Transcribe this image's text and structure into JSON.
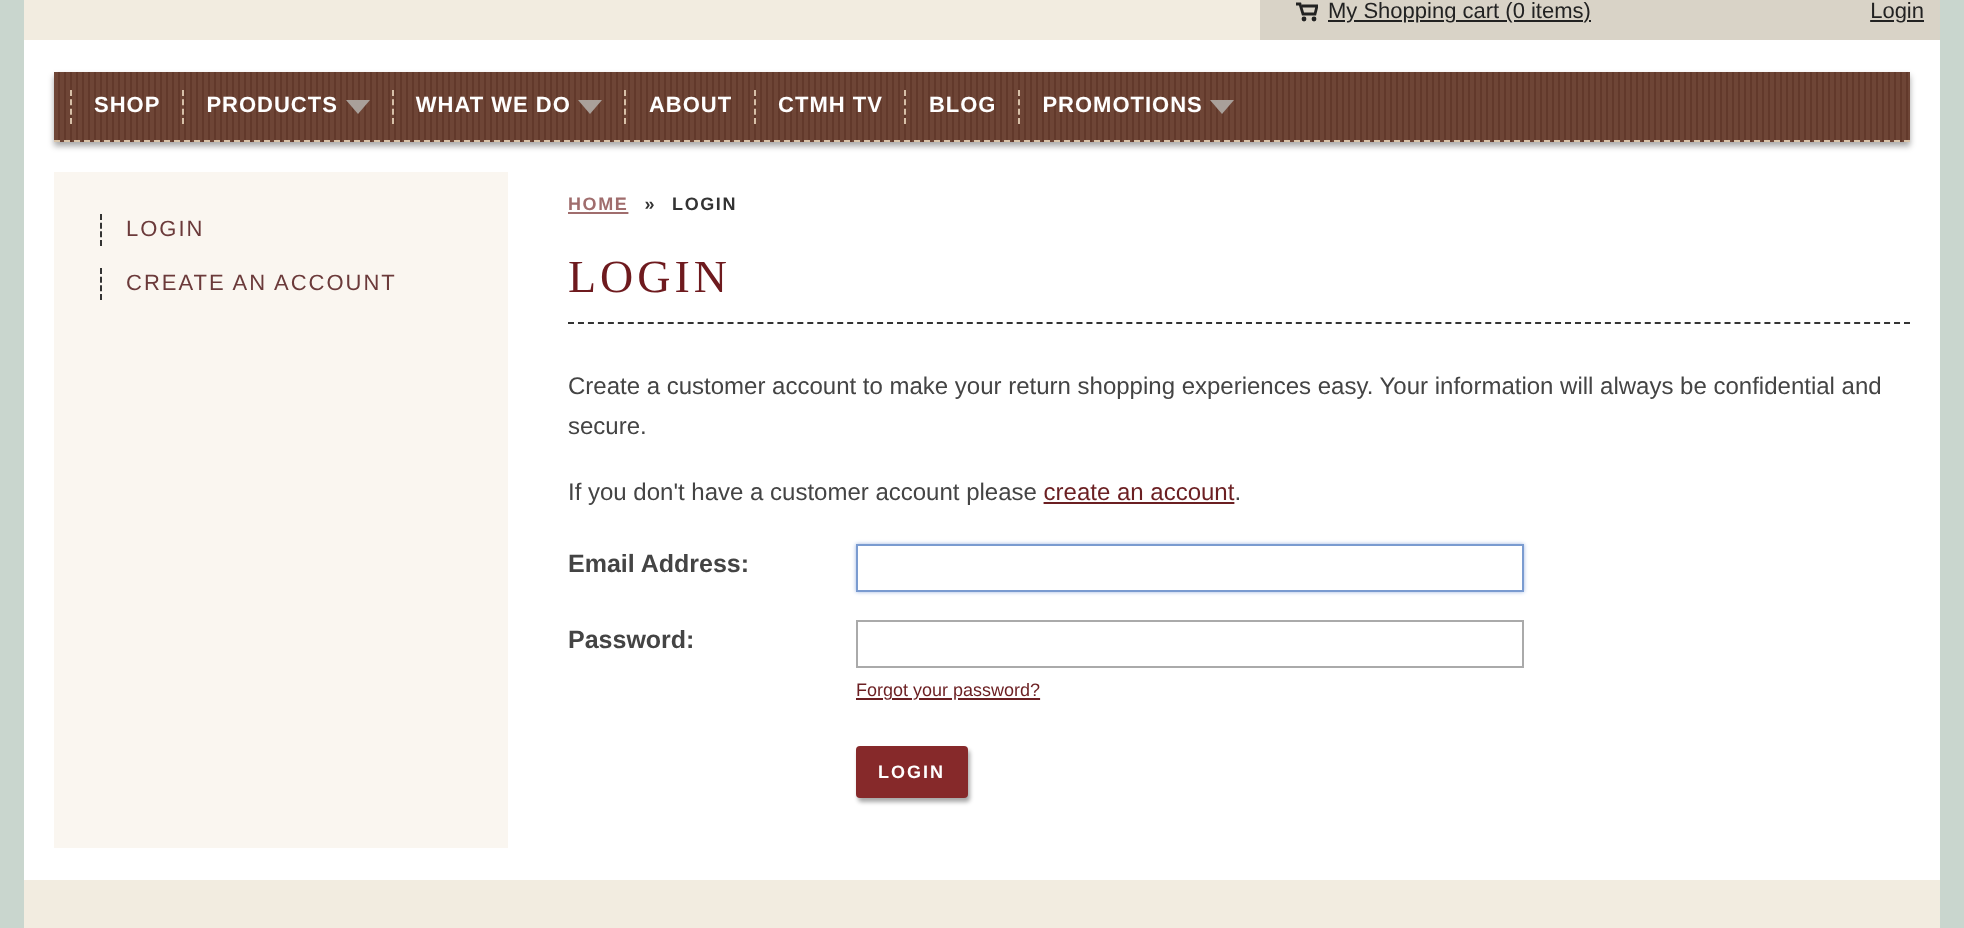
{
  "top_bar": {
    "cart_link": "My Shopping cart (0 items)",
    "login_link": "Login"
  },
  "nav": [
    {
      "label": "SHOP",
      "dropdown": false
    },
    {
      "label": "PRODUCTS",
      "dropdown": true
    },
    {
      "label": "WHAT WE DO",
      "dropdown": true
    },
    {
      "label": "ABOUT",
      "dropdown": false
    },
    {
      "label": "CTMH TV",
      "dropdown": false
    },
    {
      "label": "BLOG",
      "dropdown": false
    },
    {
      "label": "PROMOTIONS",
      "dropdown": true
    }
  ],
  "sidebar": {
    "items": [
      {
        "label": "LOGIN"
      },
      {
        "label": "CREATE AN ACCOUNT"
      }
    ]
  },
  "breadcrumb": [
    {
      "label": "HOME",
      "link": true
    },
    {
      "label": "»",
      "link": false
    },
    {
      "label": "LOGIN",
      "link": false
    }
  ],
  "heading": "LOGIN",
  "intro": "Create a customer account to make your return shopping experiences easy. Your information will always be confidential and secure.",
  "create_prompt": {
    "text": "If you don't have a customer account please",
    "link": "create an account",
    "after": "."
  },
  "form": {
    "fields": [
      {
        "label": "Email Address:",
        "kind": "email",
        "focused": true
      },
      {
        "label": "Password:",
        "kind": "password",
        "focused": false
      }
    ],
    "forgot_link": "Forgot your password?",
    "submit": "LOGIN"
  }
}
